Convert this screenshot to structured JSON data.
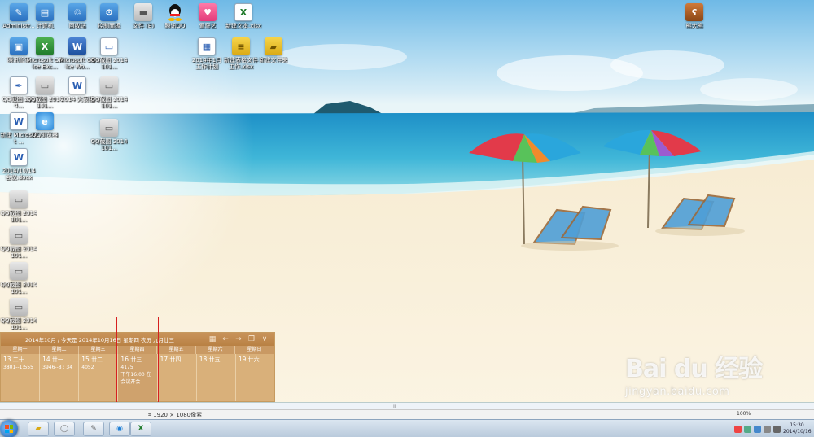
{
  "desktop": {
    "icons_col1": [
      {
        "label": "Administr...",
        "icon": "user-folder-icon"
      },
      {
        "label": "腾讯管家",
        "icon": "network-icon"
      },
      {
        "label": "Microsoft ...",
        "icon": "document-icon"
      },
      {
        "label": "QQ截图 2014...",
        "icon": "pen-icon"
      },
      {
        "label": "新建 Microsoft ...",
        "icon": "document-icon"
      },
      {
        "label": "2014/10/14 会议.docx",
        "icon": "document-icon"
      },
      {
        "label": "QQ截图 2014101...",
        "icon": "image-icon"
      },
      {
        "label": "QQ截图 2014101...",
        "icon": "image-icon"
      },
      {
        "label": "QQ截图 2014101...",
        "icon": "image-icon"
      },
      {
        "label": "QQ截图 2014101...",
        "icon": "image-icon"
      }
    ],
    "icons_top_row": [
      {
        "label": "计算机",
        "icon": "computer-icon"
      },
      {
        "label": "回收站",
        "icon": "recycle-bin-icon"
      },
      {
        "label": "控制面板",
        "icon": "control-panel-icon"
      },
      {
        "label": "文件 (E)",
        "icon": "drive-icon"
      },
      {
        "label": "腾讯QQ",
        "icon": "qq-icon"
      },
      {
        "label": "爱奇艺",
        "icon": "heart-app-icon"
      },
      {
        "label": "新建文本.xlsx",
        "icon": "spreadsheet-icon"
      }
    ],
    "icons_row2": [
      {
        "label": "Microsoft Office Exc...",
        "icon": "excel-icon"
      },
      {
        "label": "Microsoft Office Wo...",
        "icon": "word-icon"
      },
      {
        "label": "QQ截图 2014101...",
        "icon": "image-icon"
      }
    ],
    "icons_row3": [
      {
        "label": "QQ截图 2014101...",
        "icon": "image-icon"
      },
      {
        "label": "2014 大表格",
        "icon": "document-icon"
      },
      {
        "label": "QQ截图 2014101...",
        "icon": "image-icon"
      }
    ],
    "icons_misc": [
      {
        "label": "QQ浏览器",
        "icon": "browser-icon"
      },
      {
        "label": "QQ截图 2014101...",
        "icon": "image-icon"
      },
      {
        "label": "2014年1月 工作计划",
        "icon": "document-icon"
      },
      {
        "label": "新建表格文件 工作.xlsx",
        "icon": "spreadsheet-icon"
      },
      {
        "label": "新建文件夹",
        "icon": "folder-icon"
      },
      {
        "label": "熊大熊",
        "icon": "bear-icon"
      }
    ]
  },
  "calendar": {
    "header": "2014年10月 / 今天是 2014年10月16日 星期四  农历 九月廿三",
    "weekdays": [
      "星期一",
      "星期二",
      "星期三",
      "星期四",
      "星期五",
      "星期六",
      "星期日"
    ],
    "days": [
      {
        "num": "13",
        "lunar": "二十",
        "notes": [
          "3801--1:555"
        ]
      },
      {
        "num": "14",
        "lunar": "廿一",
        "notes": [
          "3946--8 : 34"
        ]
      },
      {
        "num": "15",
        "lunar": "廿二",
        "notes": [
          "4052"
        ]
      },
      {
        "num": "16",
        "lunar": "廿三",
        "notes": [
          "4175",
          "下午16:00 在",
          "会议开会"
        ]
      },
      {
        "num": "17",
        "lunar": "廿四",
        "notes": []
      },
      {
        "num": "18",
        "lunar": "廿五",
        "notes": []
      },
      {
        "num": "19",
        "lunar": "廿六",
        "notes": []
      }
    ]
  },
  "statusbar": {
    "resolution": "1920 × 1080像素",
    "zoom": "100%"
  },
  "taskbar": {
    "clock_time": "15:30",
    "clock_date": "2014/10/16"
  },
  "watermark": {
    "brand": "Bai du 经验",
    "url": "jingyan.baidu.com"
  }
}
